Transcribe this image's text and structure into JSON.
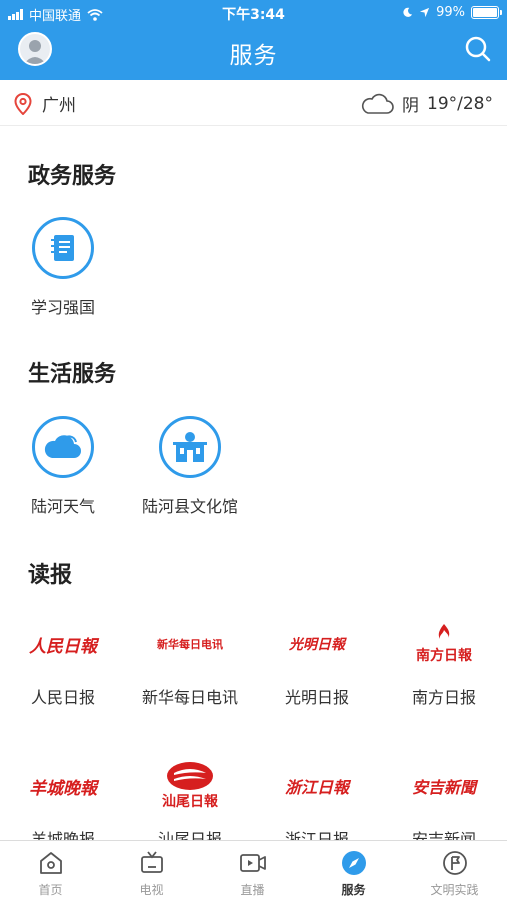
{
  "status_bar": {
    "carrier": "中国联通",
    "time": "下午3:44",
    "battery": "99%"
  },
  "header": {
    "title": "服务"
  },
  "location": {
    "city": "广州"
  },
  "weather": {
    "condition": "阴",
    "temp": "19°/28°"
  },
  "sections": {
    "gov": {
      "title": "政务服务",
      "items": [
        {
          "label": "学习强国",
          "icon": "notebook-icon"
        }
      ]
    },
    "life": {
      "title": "生活服务",
      "items": [
        {
          "label": "陆河天气",
          "icon": "cloud-icon"
        },
        {
          "label": "陆河县文化馆",
          "icon": "building-icon"
        }
      ]
    },
    "news": {
      "title": "读报",
      "items": [
        {
          "label": "人民日报",
          "logo": "人民日報"
        },
        {
          "label": "新华每日电讯",
          "logo": "新华每日电讯"
        },
        {
          "label": "光明日报",
          "logo": "光明日報"
        },
        {
          "label": "南方日报",
          "logo": "南方日報"
        },
        {
          "label": "羊城晚报",
          "logo": "羊城晚報"
        },
        {
          "label": "汕尾日报",
          "logo": "汕尾日報"
        },
        {
          "label": "浙江日报",
          "logo": "浙江日報"
        },
        {
          "label": "安吉新闻",
          "logo": "安吉新聞"
        }
      ]
    }
  },
  "tabbar": {
    "items": [
      {
        "label": "首页",
        "icon": "home-icon"
      },
      {
        "label": "电视",
        "icon": "tv-icon"
      },
      {
        "label": "直播",
        "icon": "video-camera-icon"
      },
      {
        "label": "服务",
        "icon": "compass-icon"
      },
      {
        "label": "文明实践",
        "icon": "flag-icon"
      }
    ],
    "active": "服务"
  },
  "colors": {
    "brand_blue": "#2f9bea",
    "logo_red": "#d61f1f"
  }
}
